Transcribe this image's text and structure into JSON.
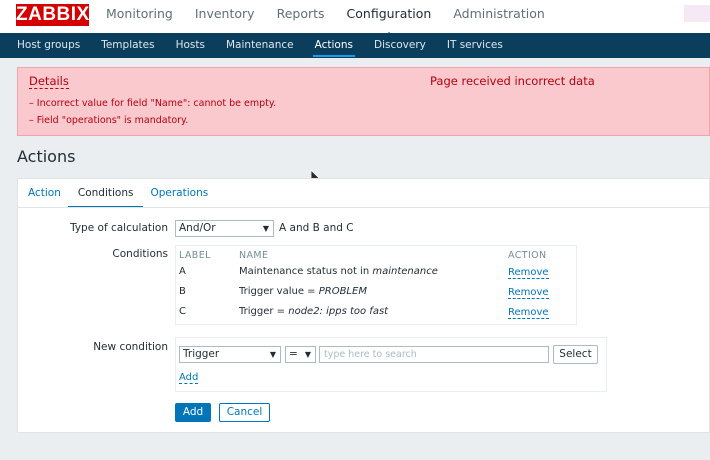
{
  "header": {
    "logo": "ZABBIX",
    "nav": [
      "Monitoring",
      "Inventory",
      "Reports",
      "Configuration",
      "Administration"
    ],
    "active_nav": "Configuration"
  },
  "subnav": {
    "items": [
      "Host groups",
      "Templates",
      "Hosts",
      "Maintenance",
      "Actions",
      "Discovery",
      "IT services"
    ],
    "active": "Actions"
  },
  "error": {
    "details_label": "Details",
    "title": "Page received incorrect data",
    "messages": [
      "– Incorrect value for field \"Name\": cannot be empty.",
      "– Field \"operations\" is mandatory."
    ]
  },
  "page": {
    "title": "Actions"
  },
  "tabs": [
    "Action",
    "Conditions",
    "Operations"
  ],
  "active_tab": "Conditions",
  "form": {
    "calc_label": "Type of calculation",
    "calc_value": "And/Or",
    "calc_formula": "A and B and C",
    "conditions_label": "Conditions",
    "columns": [
      "LABEL",
      "NAME",
      "ACTION"
    ],
    "conditions": [
      {
        "label": "A",
        "name_prefix": "Maintenance status not in ",
        "name_em": "maintenance",
        "action": "Remove"
      },
      {
        "label": "B",
        "name_prefix": "Trigger value = ",
        "name_em": "PROBLEM",
        "action": "Remove"
      },
      {
        "label": "C",
        "name_prefix": "Trigger = ",
        "name_em": "node2: ipps too fast",
        "action": "Remove"
      }
    ],
    "new_condition_label": "New condition",
    "new_condition_type": "Trigger",
    "new_condition_operator": "=",
    "search_placeholder": "type here to search",
    "select_label": "Select",
    "add_link": "Add",
    "add_button": "Add",
    "cancel_button": "Cancel"
  }
}
